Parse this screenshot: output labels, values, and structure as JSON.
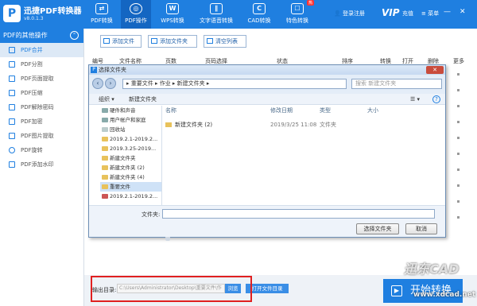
{
  "app": {
    "name": "迅捷PDF转换器",
    "version": "v8.0.1.3"
  },
  "nav": [
    {
      "label": "PDF转换",
      "icon": "pdf-convert-icon"
    },
    {
      "label": "PDF操作",
      "icon": "pdf-ops-icon"
    },
    {
      "label": "WPS转换",
      "icon": "wps-icon"
    },
    {
      "label": "文字语音转换",
      "icon": "voice-icon"
    },
    {
      "label": "CAD转换",
      "icon": "cad-icon"
    },
    {
      "label": "特色转换",
      "icon": "special-icon",
      "badge": "热"
    }
  ],
  "header": {
    "login": "登录注册",
    "vip": "VIP",
    "recharge": "充值",
    "menu": "菜单"
  },
  "sidebar": {
    "title": "PDF的其他操作",
    "items": [
      "PDF合并",
      "PDF分割",
      "PDF页面提取",
      "PDF压缩",
      "PDF解除密码",
      "PDF加密",
      "PDF图片提取",
      "PDF旋转",
      "PDF添加水印"
    ]
  },
  "toolbar": {
    "add_file": "添加文件",
    "add_folder": "添加文件夹",
    "clear": "清空列表"
  },
  "columns": [
    "编号",
    "文件名称",
    "页数",
    "页码选择",
    "状态",
    "排序",
    "转换",
    "打开",
    "删除",
    "更多"
  ],
  "dialog": {
    "title": "选择文件夹",
    "breadcrumb": "▸ 重要文件 ▸ 作业 ▸ 新建文件夹 ▸",
    "search": "搜索 新建文件夹",
    "organize": "组织 ▾",
    "new_folder": "新建文件夹",
    "tree": [
      "硬件和声音",
      "用户帐户和家庭",
      "回收站",
      "2019.2.1-2019.2...",
      "2019.3.25-2019...",
      "新建文件夹",
      "新建文件夹 (2)",
      "新建文件夹 (4)",
      "重要文件",
      "2019.2.1-2019.2..."
    ],
    "list_headers": [
      "名称",
      "修改日期",
      "类型",
      "大小"
    ],
    "rows": [
      {
        "name": "新建文件夹 (2)",
        "date": "2019/3/25 11:08",
        "type": "文件夹"
      }
    ],
    "filename_label": "文件夹:",
    "select_btn": "选择文件夹",
    "cancel_btn": "取消"
  },
  "output": {
    "label": "输出目录:",
    "path": "C:\\Users\\Administrator\\Desktop\\重要文件\\作",
    "browse": "浏览",
    "open_dir": "打开文件目录"
  },
  "start": "开始转换",
  "watermark": {
    "brand": "迅东CAD",
    "url": "www.xdcad.net"
  },
  "colors": {
    "primary": "#1f7fe0",
    "highlight": "#e02020"
  }
}
